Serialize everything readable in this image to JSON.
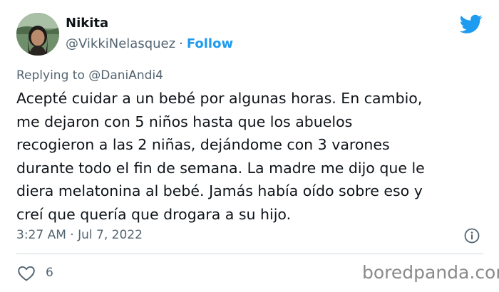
{
  "author": {
    "name": "Nikita",
    "handle": "@VikkiNelasquez",
    "separator": "·",
    "follow_label": "Follow"
  },
  "brand_icon": "twitter-bird-icon",
  "reply": {
    "prefix": "Replying to",
    "mention": "@DaniAndi4"
  },
  "tweet": {
    "lines": [
      "Acepté cuidar a un bebé por algunas horas. En cambio,",
      "me dejaron con 5 niños hasta que los abuelos",
      "recogieron a las 2 niñas, dejándome con 3 varones",
      "durante todo el fin de semana. La madre me dijo que le",
      "diera melatonina al bebé. Jamás había oído sobre eso y",
      "creí que quería que drogara a su hijo."
    ]
  },
  "meta": {
    "timestamp": "3:27 AM · Jul 7, 2022",
    "info_icon": "info-icon"
  },
  "engagement": {
    "like_icon": "heart-icon",
    "like_count": "6"
  },
  "watermark": "boredpanda.com",
  "colors": {
    "accent": "#1d9bf0",
    "text": "#0f1419",
    "secondary": "#536471",
    "divider": "#cfd9de"
  }
}
